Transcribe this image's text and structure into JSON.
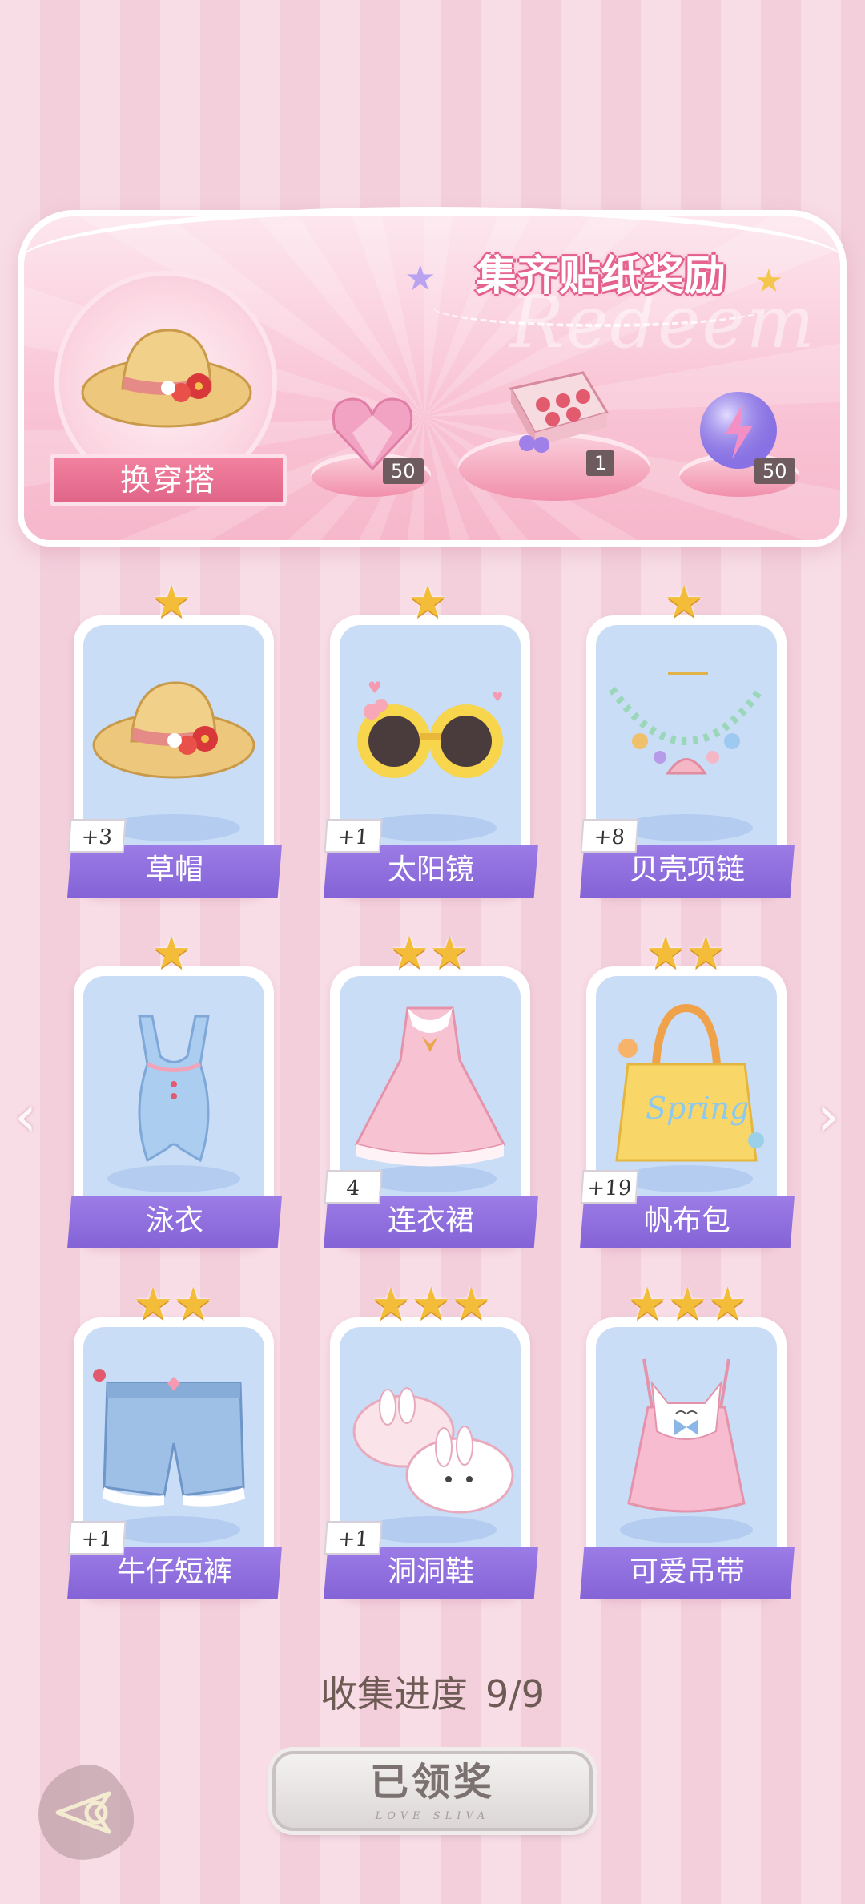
{
  "banner": {
    "title": "集齐贴纸奖励",
    "watermark": "Redeem",
    "outfit_button": "换穿搭",
    "rewards": [
      {
        "name": "heart-gem",
        "count": "50"
      },
      {
        "name": "gift-box",
        "count": "1"
      },
      {
        "name": "energy-orb",
        "count": "50"
      }
    ]
  },
  "items": [
    {
      "name": "草帽",
      "stars": 1,
      "plus": "+3"
    },
    {
      "name": "太阳镜",
      "stars": 1,
      "plus": "+1"
    },
    {
      "name": "贝壳项链",
      "stars": 1,
      "plus": "+8"
    },
    {
      "name": "泳衣",
      "stars": 1,
      "plus": ""
    },
    {
      "name": "连衣裙",
      "stars": 2,
      "plus": "4"
    },
    {
      "name": "帆布包",
      "stars": 2,
      "plus": "+19"
    },
    {
      "name": "牛仔短裤",
      "stars": 2,
      "plus": "+1"
    },
    {
      "name": "洞洞鞋",
      "stars": 3,
      "plus": "+1"
    },
    {
      "name": "可爱吊带",
      "stars": 3,
      "plus": ""
    }
  ],
  "bag_text": "Spring",
  "progress": {
    "label": "收集进度",
    "value": "9/9"
  },
  "claim_button": {
    "label": "已领奖",
    "sub": "LOVE SLIVA"
  },
  "colors": {
    "ribbon": "#8e6edb",
    "card_bg": "#c9ddf6",
    "accent_pink": "#e35a8a",
    "star": "#f3bd3a"
  }
}
